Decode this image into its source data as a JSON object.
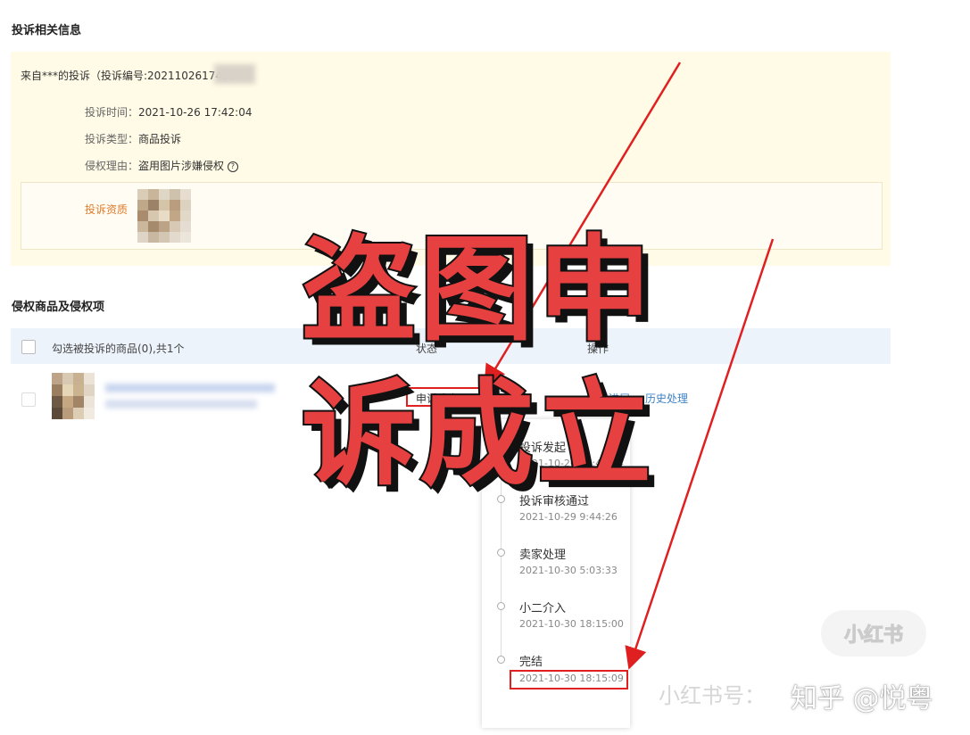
{
  "complaint_info": {
    "section_title": "投诉相关信息",
    "header": "来自***的投诉（投诉编号:2021102617420",
    "time_label": "投诉时间：",
    "time_value": "2021-10-26 17:42:04",
    "type_label": "投诉类型：",
    "type_value": "商品投诉",
    "reason_label": "侵权理由：",
    "reason_value": "盗用图片涉嫌侵权",
    "evidence_label": "投诉资质"
  },
  "products": {
    "section_title": "侵权商品及侵权项",
    "select_all_label": "勾选被投诉的商品(0),共1个",
    "col_status": "状态",
    "col_action": "操作",
    "row_status": "申诉成立",
    "action_view": "查看进展",
    "action_history": "历史处理"
  },
  "timeline": [
    {
      "title": "投诉发起",
      "time": "2021-10-26 17:42:04"
    },
    {
      "title": "投诉审核通过",
      "time": "2021-10-29 9:44:26"
    },
    {
      "title": "卖家处理",
      "time": "2021-10-30 5:03:33"
    },
    {
      "title": "小二介入",
      "time": "2021-10-30 18:15:00"
    },
    {
      "title": "完结",
      "time": "2021-10-30 18:15:09"
    }
  ],
  "overlay": {
    "line1": "盗图申",
    "line2": "诉成立"
  },
  "watermarks": {
    "logo": "小红书",
    "caption": "小红书号：",
    "zhihu": "知乎 @悦粤"
  },
  "colors": {
    "accent_red": "#e02020",
    "link_blue": "#3d82c4",
    "info_bg": "#fffbe6",
    "evidence_label": "#e07a2c"
  }
}
